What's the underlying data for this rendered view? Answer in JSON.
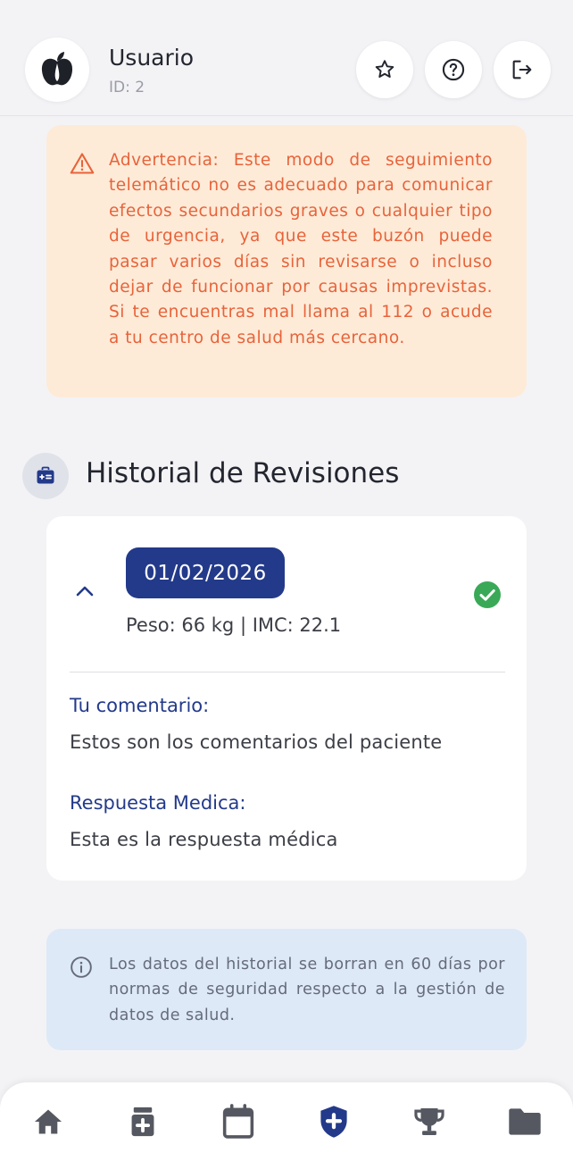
{
  "header": {
    "user_name": "Usuario",
    "user_id": "ID: 2",
    "actions": [
      "star-icon",
      "help-icon",
      "logout-icon"
    ]
  },
  "warning": {
    "text": "Advertencia: Este modo de seguimiento telemático no es adecuado para comunicar efectos secundarios graves o cualquier tipo de urgencia, ya que este buzón puede pasar varios días sin revisarse o incluso dejar de funcionar por causas imprevistas. Si te encuentras mal llama al 112 o acude a tu centro de salud más cercano."
  },
  "section": {
    "title": "Historial de Revisiones"
  },
  "review": {
    "date": "01/02/2026",
    "stats": "Peso: 66 kg | IMC: 22.1",
    "comment_label": "Tu comentario:",
    "comment_text": "Estos son los comentarios del paciente",
    "response_label": "Respuesta Medica:",
    "response_text": "Esta es la respuesta médica"
  },
  "info": {
    "text": "Los datos del historial se borran en 60 días por normas de seguridad respecto a la gestión de datos de salud."
  },
  "nav": {
    "items": [
      "home-icon",
      "medication-icon",
      "calendar-icon",
      "health-shield-icon",
      "trophy-icon",
      "folder-icon"
    ],
    "active": "health-shield-icon"
  },
  "colors": {
    "primary": "#233a8a",
    "warning_bg": "#fdebd8",
    "warning_text": "#e8633a",
    "info_bg": "#dde9f7",
    "success": "#3aa957",
    "background": "#f3f3f6"
  }
}
